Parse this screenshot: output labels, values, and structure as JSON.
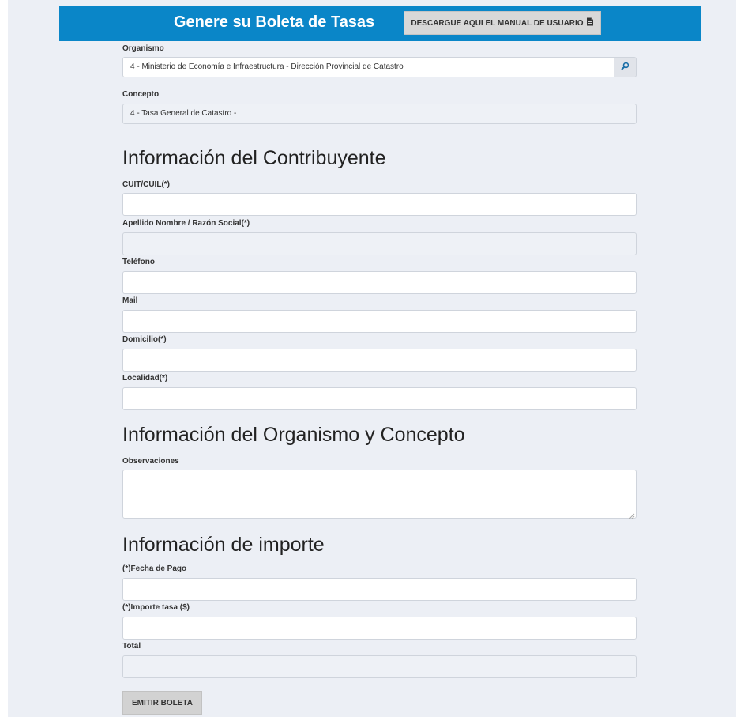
{
  "header": {
    "title": "Genere su Boleta de Tasas",
    "manual_button": "DESCARGUE AQUI EL MANUAL DE USUARIO",
    "manual_icon": "document-icon"
  },
  "organismo": {
    "label": "Organismo",
    "value": "4 - Ministerio de Economía e Infraestructura - Dirección Provincial de Catastro",
    "search_icon": "search-icon"
  },
  "concepto": {
    "label": "Concepto",
    "value": "4 - Tasa General de Catastro -"
  },
  "contribuyente": {
    "title": "Información del Contribuyente",
    "cuit_label": "CUIT/CUIL(*)",
    "cuit_value": "",
    "razon_label": "Apellido Nombre / Razón Social(*)",
    "razon_value": "",
    "telefono_label": "Teléfono",
    "telefono_value": "",
    "mail_label": "Mail",
    "mail_value": "",
    "domicilio_label": "Domicilio(*)",
    "domicilio_value": "",
    "localidad_label": "Localidad(*)",
    "localidad_value": ""
  },
  "organismo_concepto": {
    "title": "Información del Organismo y Concepto",
    "observaciones_label": "Observaciones",
    "observaciones_value": ""
  },
  "importe": {
    "title": "Información de importe",
    "fecha_label": "(*)Fecha de Pago",
    "fecha_value": "",
    "importe_label": "(*)Importe tasa ($)",
    "importe_value": "",
    "total_label": "Total",
    "total_value": ""
  },
  "submit": {
    "label": "EMITIR BOLETA"
  },
  "colors": {
    "header_bg": "#0a86c8",
    "page_bg": "#eceff5",
    "button_bg": "#d2d2d2"
  }
}
